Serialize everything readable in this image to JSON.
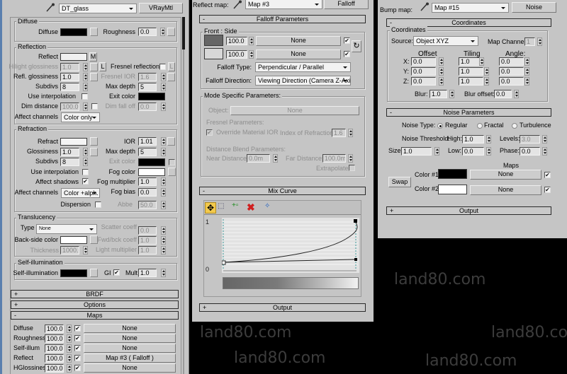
{
  "left": {
    "material_name": "DT_glass",
    "material_type": "VRayMtl",
    "diffuse": {
      "group": "Diffuse",
      "diffuse_label": "Diffuse",
      "diffuse_color": "#000000",
      "roughness_label": "Roughness",
      "roughness": "0.0"
    },
    "reflection": {
      "group": "Reflection",
      "reflect_label": "Reflect",
      "reflect_color": "#f0f0f0",
      "m_button": "M",
      "hilight_label": "Hilight glossiness",
      "hilight": "1.0",
      "l_button": "L",
      "fresnel_label": "Fresnel reflections",
      "fresnel_checked": false,
      "refl_gloss_label": "Refl. glossiness",
      "refl_gloss": "1.0",
      "fresnel_ior_label": "Fresnel IOR",
      "fresnel_ior": "1.6",
      "subdivs_label": "Subdivs",
      "subdivs": "8",
      "max_depth_label": "Max depth",
      "max_depth": "5",
      "use_interp_label": "Use interpolation",
      "use_interp_checked": false,
      "exit_color_label": "Exit color",
      "exit_color": "#000000",
      "dim_distance_label": "Dim distance",
      "dim_distance": "100.0r",
      "dim_distance_checked": false,
      "dim_falloff_label": "Dim fall off",
      "dim_falloff": "0.0",
      "affect_channels_label": "Affect channels",
      "affect_channels": "Color only"
    },
    "refraction": {
      "group": "Refraction",
      "refract_label": "Refract",
      "refract_color": "#f4f4f4",
      "ior_label": "IOR",
      "ior": "1.01",
      "glossiness_label": "Glossiness",
      "glossiness": "1.0",
      "max_depth_label": "Max depth",
      "max_depth": "5",
      "subdivs_label": "Subdivs",
      "subdivs": "8",
      "exit_color_label": "Exit color",
      "exit_color": "#000000",
      "use_interp_label": "Use interpolation",
      "use_interp_checked": false,
      "fog_color_label": "Fog color",
      "fog_color": "#ffffff",
      "affect_shadows_label": "Affect shadows",
      "affect_shadows_checked": true,
      "fog_multiplier_label": "Fog multiplier",
      "fog_multiplier": "1.0",
      "affect_channels_label": "Affect channels",
      "affect_channels": "Color +alph.",
      "fog_bias_label": "Fog bias",
      "fog_bias": "0.0",
      "dispersion_label": "Dispersion",
      "dispersion_checked": false,
      "abbe_label": "Abbe",
      "abbe": "50.0"
    },
    "translucency": {
      "group": "Translucency",
      "type_label": "Type",
      "type": "None",
      "scatter_label": "Scatter coeff",
      "scatter": "0.0",
      "backside_label": "Back-side color",
      "backside_color": "#ffffff",
      "fwdbck_label": "Fwd/bck coeff",
      "fwdbck": "1.0",
      "thickness_label": "Thickness",
      "thickness": "1000.0",
      "light_mult_label": "Light multiplier",
      "light_mult": "1.0"
    },
    "self_illum": {
      "group": "Self-illumination",
      "label": "Self-illumination",
      "color": "#000000",
      "gi_label": "GI",
      "gi_checked": true,
      "mult_label": "Mult",
      "mult": "1.0"
    },
    "rollouts": {
      "brdf": "BRDF",
      "options": "Options",
      "maps": "Maps",
      "collapsed_sign": "+",
      "expanded_sign": "-"
    },
    "maps": [
      {
        "label": "Diffuse",
        "amount": "100.0",
        "enabled": true,
        "map": "None"
      },
      {
        "label": "Roughness",
        "amount": "100.0",
        "enabled": true,
        "map": "None"
      },
      {
        "label": "Self-illum",
        "amount": "100.0",
        "enabled": true,
        "map": "None"
      },
      {
        "label": "Reflect",
        "amount": "100.0",
        "enabled": true,
        "map": "Map #3  ( Falloff )"
      },
      {
        "label": "HGlossiness",
        "amount": "100.0",
        "enabled": true,
        "map": "None"
      }
    ]
  },
  "middle": {
    "slot_label": "Reflect map:",
    "map_name": "Map #3",
    "map_type": "Falloff",
    "falloff_rollout": "Falloff Parameters",
    "front_side": {
      "group": "Front : Side",
      "front_color": "#666666",
      "front_amount": "100.0",
      "front_map": "None",
      "front_enabled": true,
      "side_color": "#d8d8d8",
      "side_amount": "100.0",
      "side_map": "None",
      "side_enabled": true,
      "falloff_type_label": "Falloff Type:",
      "falloff_type": "Perpendicular / Parallel",
      "falloff_direction_label": "Falloff Direction:",
      "falloff_direction": "Viewing Direction (Camera Z-Axis)"
    },
    "mode_specific": {
      "group": "Mode Specific Parameters:",
      "object_label": "Object:",
      "object": "None",
      "fresnel_header": "Fresnel Parameters:",
      "override_ior_label": "Override Material IOR",
      "override_ior_checked": true,
      "ior_label": "Index of Refraction",
      "ior": "1.6",
      "distance_header": "Distance Blend Parameters:",
      "near_label": "Near Distance:",
      "near": "0.0m",
      "far_label": "Far Distance:",
      "far": "100.0m",
      "extrapolate_label": "Extrapolate",
      "extrapolate_checked": false
    },
    "mix_curve_rollout": "Mix Curve",
    "curve": {
      "y_max_label": "1",
      "y_min_label": "0"
    },
    "output_rollout": "Output"
  },
  "right": {
    "slot_label": "Bump map:",
    "map_name": "Map #15",
    "map_type": "Noise",
    "coordinates_rollout": "Coordinates",
    "coordinates": {
      "group": "Coordinates",
      "source_label": "Source:",
      "source": "Object XYZ",
      "map_channel_label": "Map Channel:",
      "map_channel": "1",
      "offset_header": "Offset",
      "tiling_header": "Tiling",
      "angle_header": "Angle:",
      "rows": [
        {
          "axis": "X:",
          "offset": "0.0",
          "tiling": "1.0",
          "angle": "0.0"
        },
        {
          "axis": "Y:",
          "offset": "0.0",
          "tiling": "1.0",
          "angle": "0.0"
        },
        {
          "axis": "Z:",
          "offset": "0.0",
          "tiling": "1.0",
          "angle": "0.0"
        }
      ],
      "blur_label": "Blur:",
      "blur": "1.0",
      "blur_offset_label": "Blur offset:",
      "blur_offset": "0.0"
    },
    "noise_rollout": "Noise Parameters",
    "noise": {
      "type_label": "Noise Type:",
      "types": [
        "Regular",
        "Fractal",
        "Turbulence"
      ],
      "selected_type": "Regular",
      "threshold_label": "Noise Threshold:",
      "high_label": "High:",
      "high": "1.0",
      "levels_label": "Levels:",
      "levels": "3.0",
      "size_label": "Size:",
      "size": "1.0",
      "low_label": "Low:",
      "low": "0.0",
      "phase_label": "Phase:",
      "phase": "0.0",
      "maps_header": "Maps",
      "swap_label": "Swap",
      "color1_label": "Color #1",
      "color1": "#000000",
      "color1_map": "None",
      "color1_enabled": true,
      "color2_label": "Color #2",
      "color2": "#ffffff",
      "color2_map": "None",
      "color2_enabled": true
    },
    "output_rollout": "Output"
  },
  "watermark": "land80.com"
}
